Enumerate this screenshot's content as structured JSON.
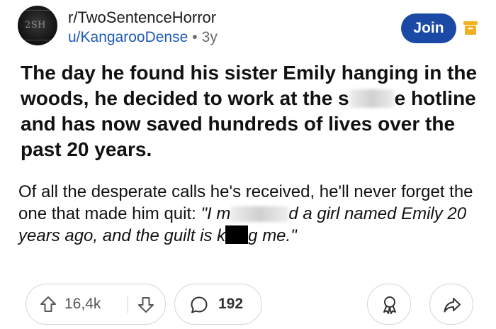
{
  "header": {
    "subreddit": "r/TwoSentenceHorror",
    "username": "u/KangarooDense",
    "separator": "•",
    "age": "3y",
    "join_label": "Join",
    "avatar_text": "2SH",
    "avatar_icon": "subreddit-avatar",
    "menu_icon": "archive-box-icon"
  },
  "post": {
    "title": "The day he found his sister Emily hanging in the woods, he decided to work at the s   e hotline and has now saved hundreds of lives over the past 20 years.",
    "title_part1": "The day he found his sister Emily hanging in the woods, he decided to work at the s",
    "title_part2": "e hotline and has now saved hundreds of lives over the past 20 years.",
    "body_part1": "Of all the desperate calls he's received, he'll never forget the one that made him quit: ",
    "quote_part1": "\"I m",
    "quote_part2": "d a girl named Emily 20 years ago, and the guilt is k",
    "quote_part3": "g me.\""
  },
  "actions": {
    "score": "16,4k",
    "comments": "192",
    "upvote_icon": "upvote-arrow-icon",
    "downvote_icon": "downvote-arrow-icon",
    "comment_icon": "speech-bubble-icon",
    "award_icon": "award-ribbon-icon",
    "share_icon": "share-arrow-icon"
  },
  "colors": {
    "accent": "#1b4aa6",
    "username": "#1f5ab5",
    "text": "#111111",
    "muted": "#6a6a6a",
    "archive_icon": "#f2b01e"
  }
}
